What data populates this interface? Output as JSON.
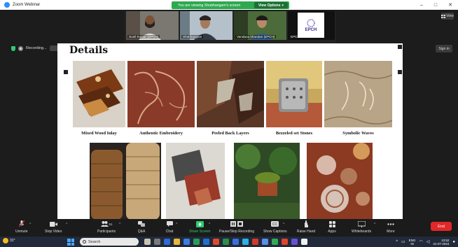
{
  "window": {
    "title": "Zoom Webinar",
    "controls": [
      "–",
      "□",
      "✕"
    ]
  },
  "banner": {
    "text": "You are viewing Shubhangam's screen",
    "options_label": "View Options",
    "options_caret": "▾"
  },
  "view": {
    "label": "View"
  },
  "recording": {
    "label": "Recording..."
  },
  "signin": {
    "label": "Sign in"
  },
  "participants_video": [
    {
      "name": "Sunil Kumar (EPCH)"
    },
    {
      "name": "Shubhangam"
    },
    {
      "name": "Vandana bhandari (EPCH)"
    },
    {
      "name": "EPCH",
      "logo_text": "EPCH"
    }
  ],
  "slide": {
    "title": "Details",
    "row1": [
      {
        "caption": "Mixed Wood Inlay"
      },
      {
        "caption": "Authentic Embroidery"
      },
      {
        "caption": "Peeled Back Layers"
      },
      {
        "caption": "Bezzeled set Stones"
      },
      {
        "caption": "Symbolic Waves"
      }
    ]
  },
  "toolbar": {
    "participants_count": "51",
    "items": [
      {
        "label": "Unmute",
        "icon": "microphone-muted-icon"
      },
      {
        "label": "Stop Video",
        "icon": "video-camera-icon"
      },
      {
        "label": "Participants",
        "icon": "participants-icon"
      },
      {
        "label": "Q&A",
        "icon": "qa-icon"
      },
      {
        "label": "Chat",
        "icon": "chat-icon"
      },
      {
        "label": "Share Screen",
        "icon": "share-screen-icon"
      },
      {
        "label": "Pause/Stop Recording",
        "icon": "pause-stop-icon"
      },
      {
        "label": "Show Captions",
        "icon": "captions-icon"
      },
      {
        "label": "Raise Hand",
        "icon": "raise-hand-icon"
      },
      {
        "label": "Apps",
        "icon": "apps-icon"
      },
      {
        "label": "Whiteboards",
        "icon": "whiteboard-icon"
      },
      {
        "label": "More",
        "icon": "more-icon"
      }
    ],
    "end_label": "End",
    "accent_share": "#2ecc71",
    "end_color": "#e02828"
  },
  "taskbar": {
    "weather_temp": "31°",
    "search_placeholder": "Search",
    "lang_top": "ENG",
    "lang_bottom": "IN",
    "time": "13:52",
    "date": "31-07-2024"
  }
}
